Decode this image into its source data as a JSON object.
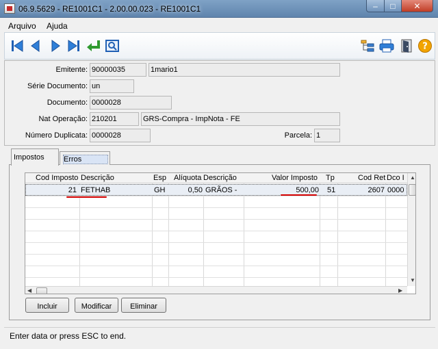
{
  "window": {
    "title": "06.9.5629 - RE1001C1 - 2.00.00.023 - RE1001C1",
    "minimize": "‒",
    "maximize": "□",
    "close": "✕"
  },
  "menu": {
    "file": "Arquivo",
    "help": "Ajuda"
  },
  "toolbar": {
    "icons": [
      "first-icon",
      "previous-icon",
      "next-icon",
      "last-icon",
      "return-icon",
      "zoom-icon",
      "tree-icon",
      "print-icon",
      "exit-icon",
      "help-icon"
    ]
  },
  "form": {
    "emitente_label": "Emitente:",
    "emitente_code": "90000035",
    "emitente_name": "1mario1",
    "serie_label": "Série Documento:",
    "serie_value": "un",
    "documento_label": "Documento:",
    "documento_value": "0000028",
    "nat_label": "Nat Operação:",
    "nat_code": "210201",
    "nat_desc": "GRS-Compra - ImpNota - FE",
    "dup_label": "Número Duplicata:",
    "dup_value": "0000028",
    "parcela_label": "Parcela:",
    "parcela_value": "1"
  },
  "tabs": {
    "impostos": "Impostos",
    "erros": "Erros"
  },
  "grid": {
    "columns": [
      "Cod Imposto",
      "Descrição",
      "Esp",
      "Alíquota",
      "Descrição",
      "Valor Imposto",
      "Tp",
      "Cod Ret",
      "Dco I"
    ],
    "rows": [
      {
        "cod": "21",
        "desc": "FETHAB",
        "esp": "GH",
        "aliquota": "0,50",
        "desc2": "GRÃOS -",
        "valor": "500,00",
        "tp": "51",
        "codret": "2607",
        "dco": "0000"
      }
    ]
  },
  "buttons": {
    "incluir": "Incluir",
    "modificar": "Modificar",
    "eliminar": "Eliminar"
  },
  "status": "Enter data or press ESC to end.",
  "colors": {
    "titlebar": "#6f93bb",
    "toolbar_icon": "#1f5fb4",
    "highlight_underline": "#d40000",
    "help_icon": "#f2a400"
  }
}
